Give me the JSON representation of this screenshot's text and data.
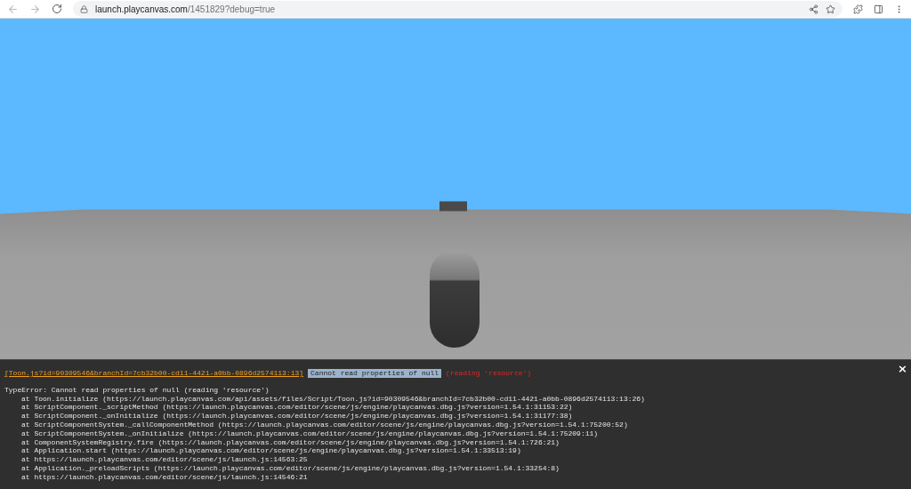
{
  "browser": {
    "url_host": "launch.playcanvas.com",
    "url_path": "/1451829?debug=true"
  },
  "console": {
    "source_link": "[Toon.js?id=90309546&branchId=7cb32b00-cd11-4421-a0bb-0896d2574113:13]",
    "message": "Cannot read properties of null",
    "detail": "(reading 'resource')",
    "close": "×",
    "error": "TypeError: Cannot read properties of null (reading 'resource')",
    "stack": [
      "at Toon.initialize (https://launch.playcanvas.com/api/assets/files/Script/Toon.js?id=90309546&branchId=7cb32b00-cd11-4421-a0bb-0896d2574113:13:26)",
      "at ScriptComponent._scriptMethod (https://launch.playcanvas.com/editor/scene/js/engine/playcanvas.dbg.js?version=1.54.1:31153:22)",
      "at ScriptComponent._onInitialize (https://launch.playcanvas.com/editor/scene/js/engine/playcanvas.dbg.js?version=1.54.1:31177:38)",
      "at ScriptComponentSystem._callComponentMethod (https://launch.playcanvas.com/editor/scene/js/engine/playcanvas.dbg.js?version=1.54.1:75200:52)",
      "at ScriptComponentSystem._onInitialize (https://launch.playcanvas.com/editor/scene/js/engine/playcanvas.dbg.js?version=1.54.1:75209:11)",
      "at ComponentSystemRegistry.fire (https://launch.playcanvas.com/editor/scene/js/engine/playcanvas.dbg.js?version=1.54.1:726:21)",
      "at Application.start (https://launch.playcanvas.com/editor/scene/js/engine/playcanvas.dbg.js?version=1.54.1:33513:19)",
      "at https://launch.playcanvas.com/editor/scene/js/launch.js:14563:25",
      "at Application._preloadScripts (https://launch.playcanvas.com/editor/scene/js/engine/playcanvas.dbg.js?version=1.54.1:33254:8)",
      "at https://launch.playcanvas.com/editor/scene/js/launch.js:14546:21"
    ]
  }
}
